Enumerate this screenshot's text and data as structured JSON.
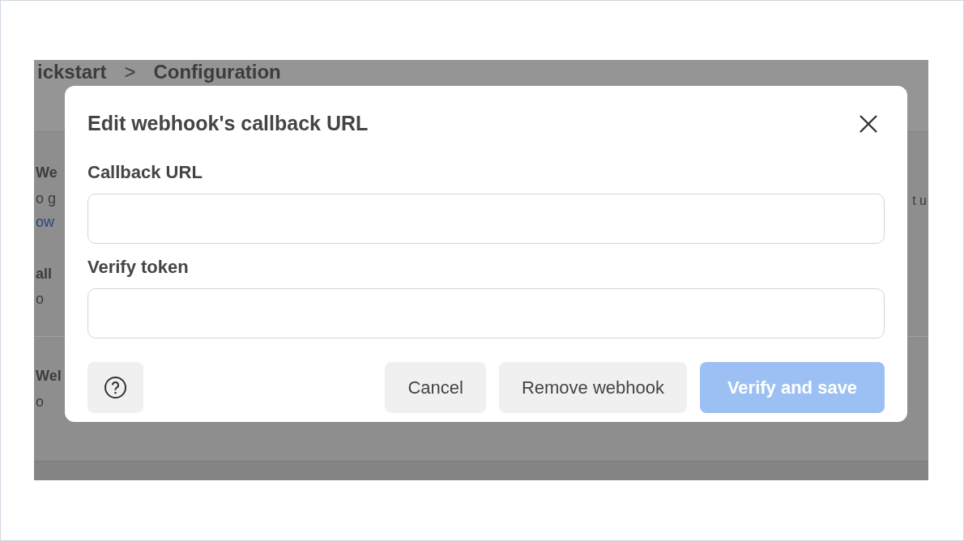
{
  "background": {
    "breadcrumb": {
      "items": [
        "ickstart",
        "Configuration"
      ],
      "separator": ">"
    },
    "sections": [
      {
        "title": "We",
        "text": "o g",
        "link": "ow",
        "right_text": "t u"
      },
      {
        "title": "all",
        "text": "o"
      },
      {
        "title": "Wel",
        "text": "o"
      }
    ]
  },
  "dialog": {
    "title": "Edit webhook's callback URL",
    "fields": [
      {
        "label": "Callback URL"
      },
      {
        "label": "Verify token"
      }
    ],
    "buttons": [
      {
        "kind": "help",
        "disabled": false
      },
      {
        "kind": "secondary",
        "label": "Cancel",
        "disabled": false
      },
      {
        "kind": "secondary",
        "label": "Remove webhook",
        "disabled": false
      },
      {
        "kind": "primary",
        "label": "Verify and save",
        "disabled": true
      }
    ]
  }
}
